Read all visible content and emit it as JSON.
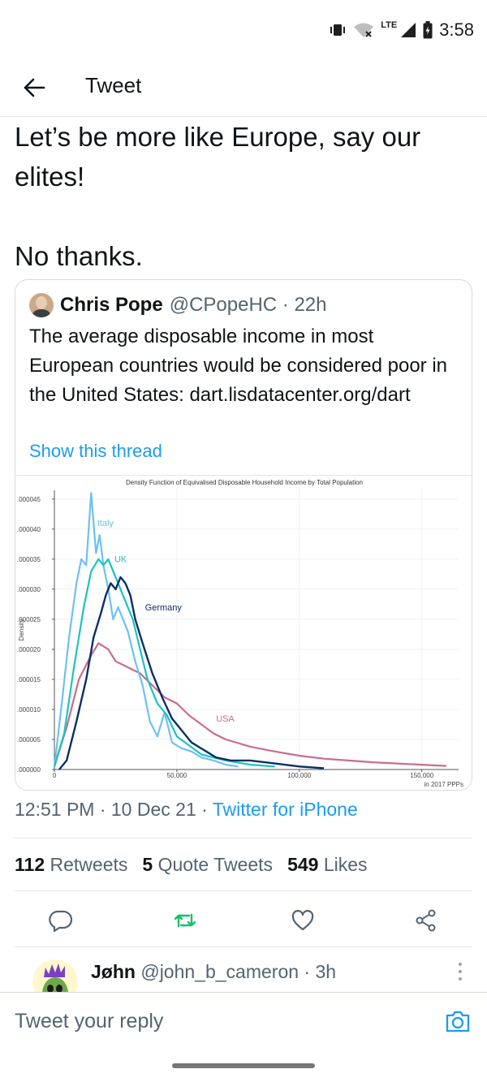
{
  "status": {
    "network": "LTE",
    "time": "3:58"
  },
  "header": {
    "title": "Tweet"
  },
  "tweet": {
    "text": "Let’s be more like Europe, say our elites!\n\nNo thanks.",
    "timestamp": "12:51 PM · 10 Dec 21 · ",
    "source": "Twitter for iPhone"
  },
  "quote": {
    "name": "Chris Pope",
    "handle_time": "@CPopeHC · 22h",
    "text": "The average disposable income in most European countries would be considered poor in the United States: dart.lisdatacenter.org/dart",
    "show_thread": "Show this thread"
  },
  "stats": {
    "retweets_count": "112",
    "retweets_label": "Retweets",
    "quotes_count": "5",
    "quotes_label": "Quote Tweets",
    "likes_count": "549",
    "likes_label": "Likes"
  },
  "reply_preview": {
    "name": "Jøhn",
    "handle_time": "@john_b_cameron · 3h"
  },
  "reply_bar": {
    "placeholder": "Tweet your reply"
  },
  "icons": {
    "back": "arrow-left-icon",
    "reply": "comment-icon",
    "retweet": "retweet-icon",
    "like": "heart-icon",
    "share": "share-icon",
    "camera": "camera-icon",
    "more": "more-vertical-icon",
    "wifi": "wifi-icon",
    "signal": "signal-icon",
    "battery": "battery-icon",
    "vibrate": "vibrate-icon"
  },
  "colors": {
    "accent": "#1d9bf0",
    "italy": "#6ec1f0",
    "uk": "#19c4c0",
    "germany": "#0b2f66",
    "usa": "#c96c8e"
  },
  "chart_data": {
    "type": "line",
    "title": "Density Function of Equivalised Disposable Household Income by Total Population",
    "xlabel": "in 2017 PPPs",
    "ylabel": "Density",
    "xlim": [
      0,
      165000
    ],
    "ylim": [
      0,
      4.7e-05
    ],
    "x_ticks": [
      "0",
      "50,000",
      "100,000",
      "150,000"
    ],
    "x_tick_values": [
      0,
      50000,
      100000,
      150000
    ],
    "y_ticks": [
      ".000000",
      ".000005",
      ".000010",
      ".000015",
      ".000020",
      ".000025",
      ".000030",
      ".000035",
      ".000040",
      ".000045"
    ],
    "y_tick_values": [
      0,
      5e-06,
      1e-05,
      1.5e-05,
      2e-05,
      2.5e-05,
      3e-05,
      3.5e-05,
      4e-05,
      4.5e-05
    ],
    "grid": true,
    "series": [
      {
        "name": "Italy",
        "color": "#6ec1f0",
        "x": [
          0,
          3000,
          6000,
          9000,
          11000,
          13000,
          15000,
          16000,
          17000,
          18500,
          20000,
          22000,
          24000,
          26000,
          28000,
          30000,
          33000,
          36000,
          39000,
          42000,
          45000,
          48000,
          52000,
          56000,
          60000,
          65000,
          70000,
          75000
        ],
        "y": [
          5e-07,
          1.1e-05,
          2.2e-05,
          3.1e-05,
          3.5e-05,
          3.4e-05,
          4.6e-05,
          4.1e-05,
          3.6e-05,
          3.9e-05,
          3.4e-05,
          3e-05,
          2.5e-05,
          2.7e-05,
          2.5e-05,
          2.3e-05,
          1.8e-05,
          1.4e-05,
          8e-06,
          5.5e-06,
          9.5e-06,
          4.5e-06,
          3.5e-06,
          3e-06,
          2e-06,
          1.5e-06,
          8e-07,
          5e-07
        ]
      },
      {
        "name": "UK",
        "color": "#19c4c0",
        "x": [
          0,
          4000,
          8000,
          12000,
          15000,
          18000,
          20000,
          22000,
          24000,
          26000,
          28000,
          30000,
          32000,
          35000,
          38000,
          42000,
          46000,
          50000,
          55000,
          60000,
          65000,
          70000,
          80000,
          90000
        ],
        "y": [
          5e-07,
          6e-06,
          1.7e-05,
          2.7e-05,
          3.3e-05,
          3.5e-05,
          3.4e-05,
          3.5e-05,
          3.3e-05,
          3.1e-05,
          2.9e-05,
          2.7e-05,
          2.5e-05,
          2e-05,
          1.5e-05,
          1.1e-05,
          9e-06,
          5.5e-06,
          4e-06,
          2.5e-06,
          2e-06,
          1.5e-06,
          8e-07,
          5e-07
        ]
      },
      {
        "name": "Germany",
        "color": "#0b2f66",
        "x": [
          2000,
          5000,
          9000,
          13000,
          16000,
          19000,
          21000,
          23000,
          25000,
          27000,
          29000,
          31000,
          33000,
          36000,
          40000,
          44000,
          48000,
          52000,
          56000,
          60000,
          66000,
          72000,
          80000,
          90000,
          100000,
          110000
        ],
        "y": [
          0,
          1.5e-06,
          8e-06,
          1.5e-05,
          2.2e-05,
          2.6e-05,
          2.9e-05,
          3.1e-05,
          3e-05,
          3.2e-05,
          3.1e-05,
          2.9e-05,
          2.5e-05,
          2.1e-05,
          1.6e-05,
          1.2e-05,
          8.5e-06,
          6.5e-06,
          4.5e-06,
          3.5e-06,
          2e-06,
          1.5e-06,
          1.5e-06,
          1e-06,
          5e-07,
          2e-07
        ]
      },
      {
        "name": "USA",
        "color": "#c96c8e",
        "x": [
          0,
          5000,
          10000,
          15000,
          18000,
          22000,
          25000,
          30000,
          35000,
          40000,
          45000,
          50000,
          55000,
          60000,
          65000,
          70000,
          80000,
          90000,
          100000,
          110000,
          120000,
          130000,
          140000,
          150000,
          160000
        ],
        "y": [
          5e-07,
          7e-06,
          1.5e-05,
          1.9e-05,
          2.1e-05,
          2e-05,
          1.8e-05,
          1.7e-05,
          1.6e-05,
          1.4e-05,
          1.2e-05,
          1.1e-05,
          9e-06,
          7.5e-06,
          6e-06,
          5e-06,
          3.8e-06,
          3e-06,
          2.3e-06,
          1.8e-06,
          1.5e-06,
          1.2e-06,
          1e-06,
          8e-07,
          6e-07
        ]
      }
    ]
  }
}
